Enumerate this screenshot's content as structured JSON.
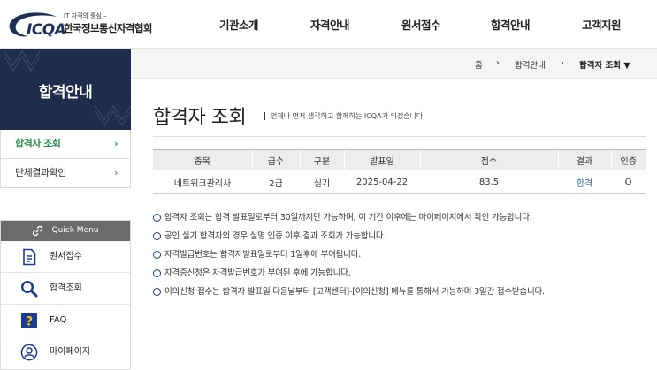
{
  "header": {
    "logo_tagline": "IT 자격의 중심 –",
    "logo_text": "ICQA",
    "logo_org": "한국정보통신자격협회",
    "nav": [
      "기관소개",
      "자격안내",
      "원서접수",
      "합격안내",
      "고객지원"
    ]
  },
  "sidebar": {
    "title": "합격안내",
    "items": [
      {
        "label": "합격자 조회",
        "active": true
      },
      {
        "label": "단체결과확인",
        "active": false
      }
    ],
    "chevron": "›"
  },
  "quick_menu": {
    "title": "Quick Menu",
    "items": [
      {
        "label": "원서접수",
        "icon": "document-icon"
      },
      {
        "label": "합격조회",
        "icon": "search-icon"
      },
      {
        "label": "FAQ",
        "icon": "question-icon"
      },
      {
        "label": "마이페이지",
        "icon": "user-icon"
      }
    ]
  },
  "breadcrumb": {
    "home": "홈",
    "sep": "›",
    "level1": "합격안내",
    "current": "합격자 조회 ▼"
  },
  "main": {
    "title": "합격자 조회",
    "subtitle": "언제나 먼저 생각하고 함께하는 ICQA가 되겠습니다.",
    "table": {
      "headers": [
        "종목",
        "급수",
        "구분",
        "발표일",
        "점수",
        "결과",
        "인증"
      ],
      "rows": [
        [
          "네트워크관리사",
          "2급",
          "실기",
          "2025-04-22",
          "83.5",
          "합격",
          "O"
        ]
      ]
    },
    "notes": [
      "합격자 조회는 합격 발표일로부터 30일까지만 가능하며, 이 기간 이후에는 마이페이지에서 확인 가능합니다.",
      "공인 실기 합격자의 경우 실명 인증 이후 결과 조회가 가능합니다.",
      "자격발급번호는 합격자발표일로부터 1일후에 부여됩니다.",
      "자격증신청은 자격발급번호가 부여된 후에 가능합니다.",
      "이의신청 접수는 합격자 발표일 다음날부터 [고객센터]-[이의신청] 메뉴를 통해서 가능하며 3일간 접수받습니다."
    ]
  },
  "colors": {
    "navy": "#1e2d4c",
    "active_green": "#2a8a4a",
    "link_blue": "#2a67b1",
    "bullet_blue": "#1d3b8f"
  }
}
